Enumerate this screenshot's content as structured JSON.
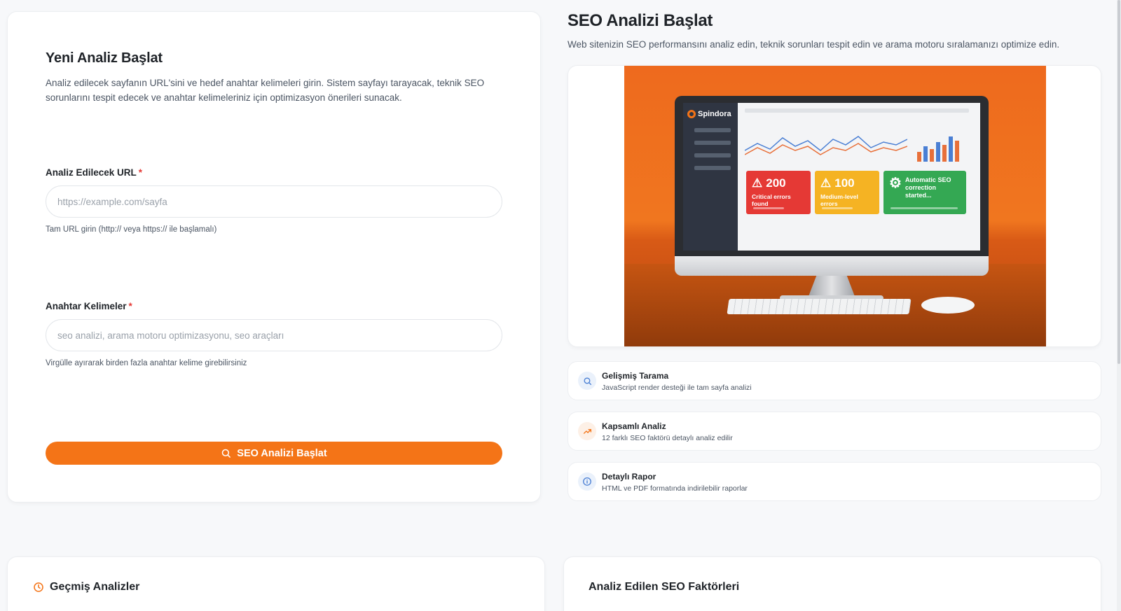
{
  "form": {
    "title": "Yeni Analiz Başlat",
    "description": "Analiz edilecek sayfanın URL'sini ve hedef anahtar kelimeleri girin. Sistem sayfayı tarayacak, teknik SEO sorunlarını tespit edecek ve anahtar kelimeleriniz için optimizasyon önerileri sunacak.",
    "url_label": "Analiz Edilecek URL",
    "url_placeholder": "https://example.com/sayfa",
    "url_value": "",
    "url_hint": "Tam URL girin (http:// veya https:// ile başlamalı)",
    "keywords_label": "Anahtar Kelimeler",
    "keywords_placeholder": "seo analizi, arama motoru optimizasyonu, seo araçları",
    "keywords_value": "",
    "keywords_hint": "Virgülle ayırarak birden fazla anahtar kelime girebilirsiniz",
    "required_mark": "*",
    "submit_label": "SEO Analizi Başlat",
    "submit_icon": "search-icon",
    "accent_color": "#f47417"
  },
  "hero": {
    "title": "SEO Analizi Başlat",
    "subtitle": "Web sitenizin SEO performansını analiz edin, teknik sorunları tespit edin ve arama motoru sıralamanızı optimize edin.",
    "illustration": {
      "brand": "Spindora",
      "tiles": [
        {
          "value": "200",
          "label": "Critical errors found",
          "color": "#e53935",
          "icon": "warning-icon"
        },
        {
          "value": "100",
          "label": "Medium-level errors",
          "color": "#f5b323",
          "icon": "warning-icon"
        },
        {
          "value": "",
          "label": "Automatic SEO correction started...",
          "color": "#34a853",
          "icon": "gear-icon"
        }
      ]
    }
  },
  "features": [
    {
      "title": "Gelişmiş Tarama",
      "desc": "JavaScript render desteği ile tam sayfa analizi",
      "icon": "search-icon",
      "color": "#4a7fd4"
    },
    {
      "title": "Kapsamlı Analiz",
      "desc": "12 farklı SEO faktörü detaylı analiz edilir",
      "icon": "trending-up-icon",
      "color": "#f47417"
    },
    {
      "title": "Detaylı Rapor",
      "desc": "HTML ve PDF formatında indirilebilir raporlar",
      "icon": "info-icon",
      "color": "#4a7fd4"
    }
  ],
  "history": {
    "title": "Geçmiş Analizler",
    "icon": "clock-icon"
  },
  "factors": {
    "title": "Analiz Edilen SEO Faktörleri"
  }
}
